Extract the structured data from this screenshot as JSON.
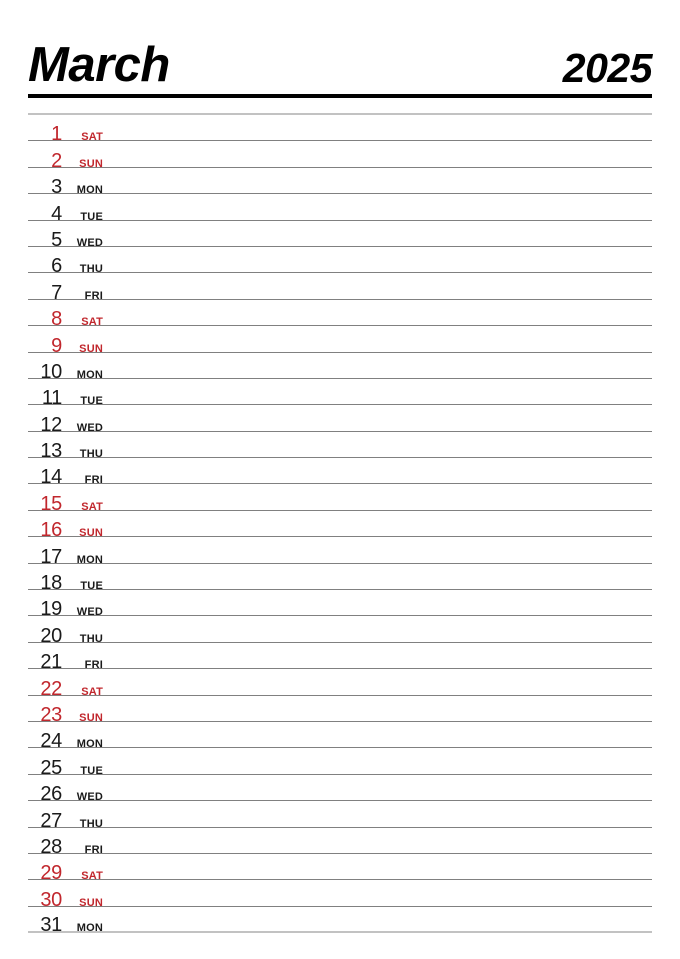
{
  "header": {
    "month": "March",
    "year": "2025"
  },
  "colors": {
    "weekend": "#c1272d",
    "weekday": "#1a1a1a",
    "header_rule": "#000000",
    "row_rule": "#808080",
    "edge_rule": "#c2c2c2",
    "background": "#ffffff"
  },
  "calendar": {
    "month": "March",
    "year": "2025",
    "days": [
      {
        "num": "1",
        "abbr": "SAT",
        "weekend": true
      },
      {
        "num": "2",
        "abbr": "SUN",
        "weekend": true
      },
      {
        "num": "3",
        "abbr": "MON",
        "weekend": false
      },
      {
        "num": "4",
        "abbr": "TUE",
        "weekend": false
      },
      {
        "num": "5",
        "abbr": "WED",
        "weekend": false
      },
      {
        "num": "6",
        "abbr": "THU",
        "weekend": false
      },
      {
        "num": "7",
        "abbr": "FRI",
        "weekend": false
      },
      {
        "num": "8",
        "abbr": "SAT",
        "weekend": true
      },
      {
        "num": "9",
        "abbr": "SUN",
        "weekend": true
      },
      {
        "num": "10",
        "abbr": "MON",
        "weekend": false
      },
      {
        "num": "11",
        "abbr": "TUE",
        "weekend": false
      },
      {
        "num": "12",
        "abbr": "WED",
        "weekend": false
      },
      {
        "num": "13",
        "abbr": "THU",
        "weekend": false
      },
      {
        "num": "14",
        "abbr": "FRI",
        "weekend": false
      },
      {
        "num": "15",
        "abbr": "SAT",
        "weekend": true
      },
      {
        "num": "16",
        "abbr": "SUN",
        "weekend": true
      },
      {
        "num": "17",
        "abbr": "MON",
        "weekend": false
      },
      {
        "num": "18",
        "abbr": "TUE",
        "weekend": false
      },
      {
        "num": "19",
        "abbr": "WED",
        "weekend": false
      },
      {
        "num": "20",
        "abbr": "THU",
        "weekend": false
      },
      {
        "num": "21",
        "abbr": "FRI",
        "weekend": false
      },
      {
        "num": "22",
        "abbr": "SAT",
        "weekend": true
      },
      {
        "num": "23",
        "abbr": "SUN",
        "weekend": true
      },
      {
        "num": "24",
        "abbr": "MON",
        "weekend": false
      },
      {
        "num": "25",
        "abbr": "TUE",
        "weekend": false
      },
      {
        "num": "26",
        "abbr": "WED",
        "weekend": false
      },
      {
        "num": "27",
        "abbr": "THU",
        "weekend": false
      },
      {
        "num": "28",
        "abbr": "FRI",
        "weekend": false
      },
      {
        "num": "29",
        "abbr": "SAT",
        "weekend": true
      },
      {
        "num": "30",
        "abbr": "SUN",
        "weekend": true
      },
      {
        "num": "31",
        "abbr": "MON",
        "weekend": false
      }
    ]
  }
}
